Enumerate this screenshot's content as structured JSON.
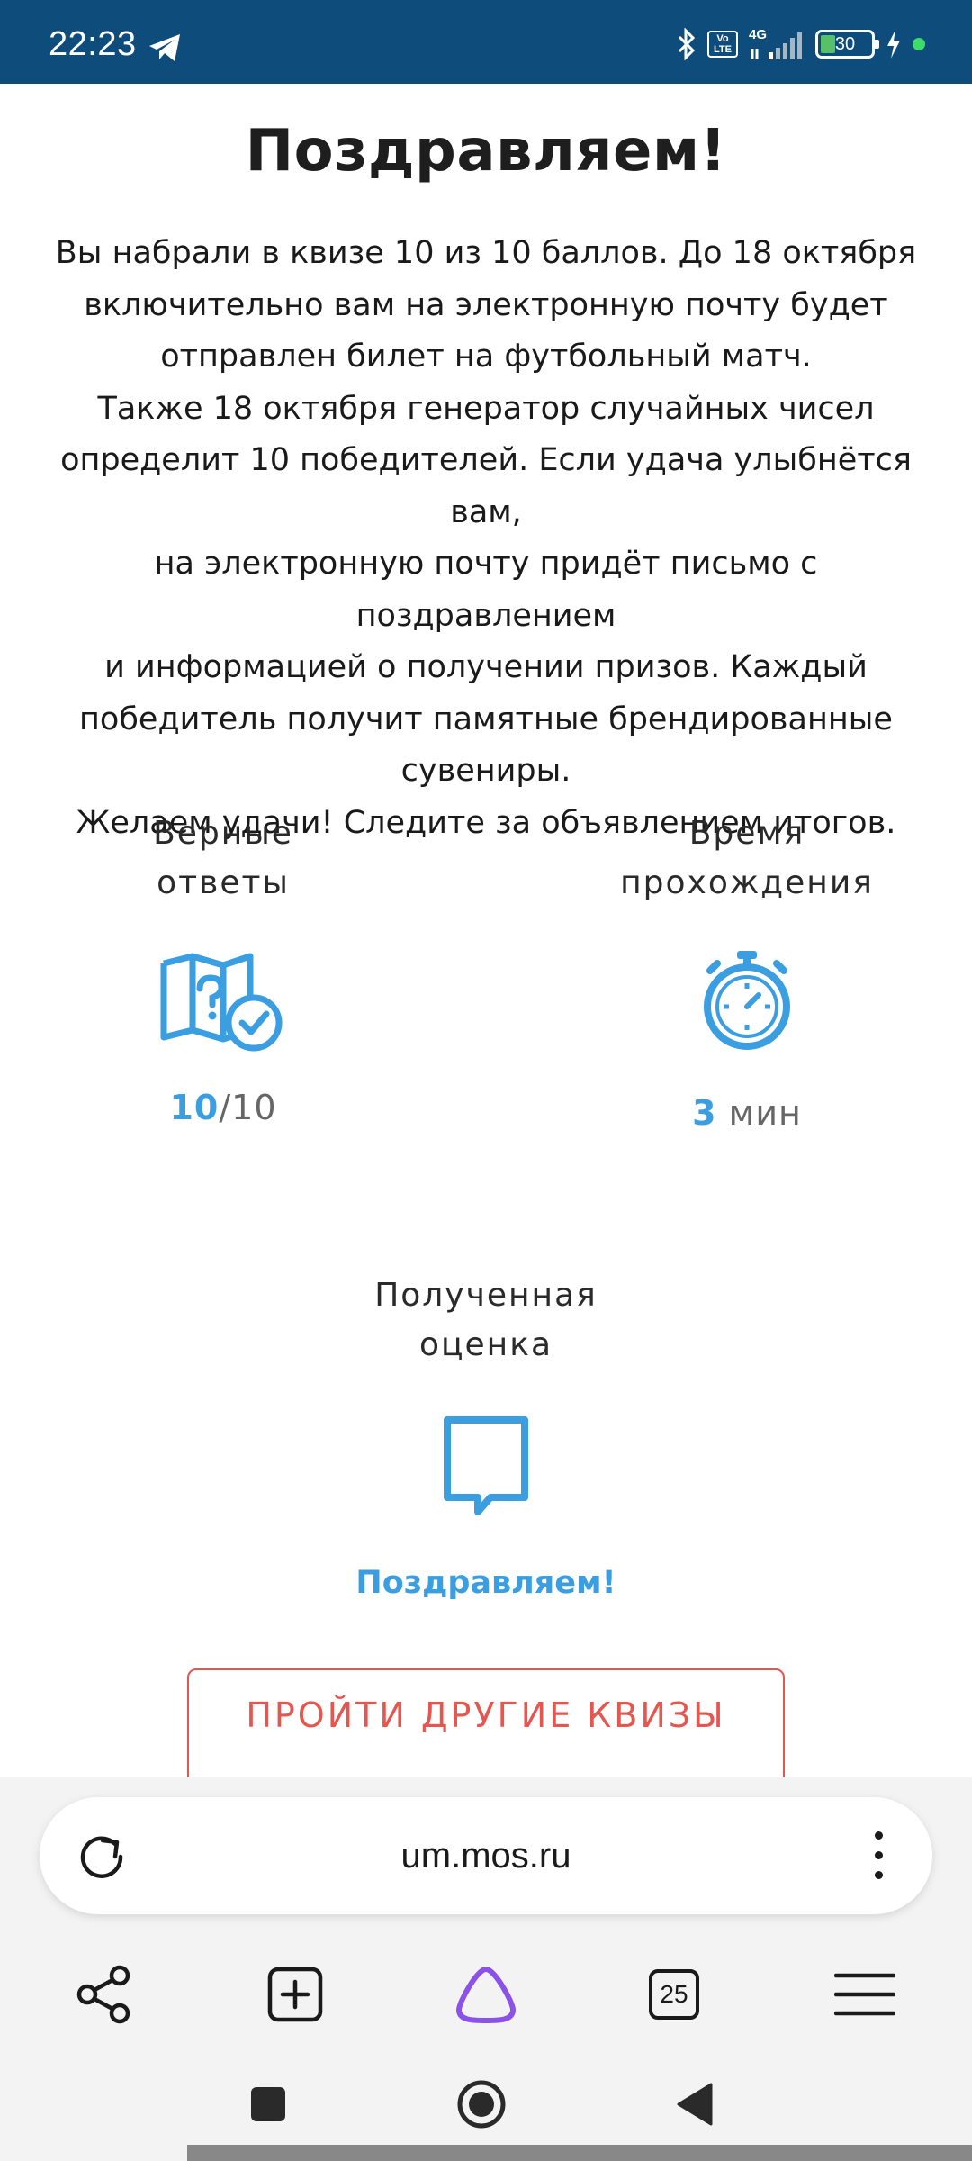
{
  "status_bar": {
    "time": "22:23",
    "battery_level": "30",
    "network": "4G",
    "volte": "Vo LTE",
    "icons": [
      "telegram-icon",
      "bluetooth-icon",
      "volte-icon",
      "signal-4g-icon",
      "battery-icon",
      "charging-icon"
    ]
  },
  "page": {
    "headline": "Поздравляем!",
    "message": "Вы набрали в квизе 10 из 10 баллов. До 18 октября\nвключительно вам на электронную почту будет\nотправлен билет на футбольный матч.\nТакже 18 октября генератор случайных чисел\nопределит 10 победителей. Если удача улыбнётся вам,\nна электронную почту придёт письмо с поздравлением\nи информацией о получении призов. Каждый\nпобедитель получит памятные брендированные\nсувениры.\nЖелаем удачи! Следите за объявлением итогов.",
    "stats": {
      "correct": {
        "label": "Верные\nответы",
        "value": "10",
        "total": "/10",
        "icon": "map-question-check-icon"
      },
      "time": {
        "label": "Время\nпрохождения",
        "value": "3",
        "unit": " мин",
        "icon": "stopwatch-icon"
      },
      "grade": {
        "label": "Полученная\nоценка",
        "value": "Поздравляем!",
        "icon": "speech-bubble-icon"
      }
    },
    "more_quizzes_button": "ПРОЙТИ ДРУГИЕ КВИЗЫ"
  },
  "browser": {
    "url": "um.mos.ru",
    "tabs_count": "25",
    "toolbar_icons": [
      "share-icon",
      "new-tab-icon",
      "alice-assistant-icon",
      "tabs-icon",
      "menu-icon"
    ]
  },
  "colors": {
    "status_bar_bg": "#0e4c7c",
    "accent_blue": "#3b9ee1",
    "button_red": "#e5564f",
    "alice_purple": "#8a52e8"
  }
}
